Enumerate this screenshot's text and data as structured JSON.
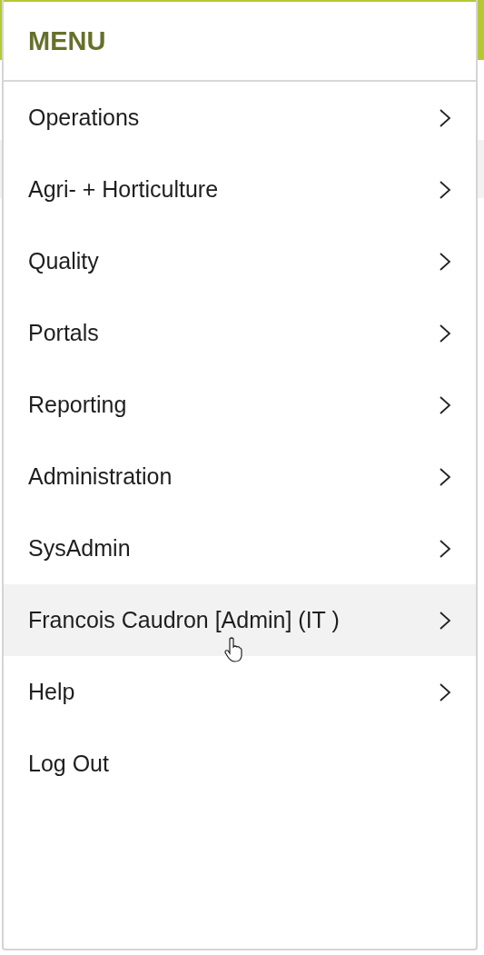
{
  "menu": {
    "title": "MENU",
    "items": [
      {
        "label": "Operations",
        "has_submenu": true,
        "highlighted": false
      },
      {
        "label": "Agri- + Horticulture",
        "has_submenu": true,
        "highlighted": false
      },
      {
        "label": "Quality",
        "has_submenu": true,
        "highlighted": false
      },
      {
        "label": "Portals",
        "has_submenu": true,
        "highlighted": false
      },
      {
        "label": "Reporting",
        "has_submenu": true,
        "highlighted": false
      },
      {
        "label": "Administration",
        "has_submenu": true,
        "highlighted": false
      },
      {
        "label": "SysAdmin",
        "has_submenu": true,
        "highlighted": false
      },
      {
        "label": "Francois Caudron [Admin] (IT )",
        "has_submenu": true,
        "highlighted": true
      },
      {
        "label": "Help",
        "has_submenu": true,
        "highlighted": false
      },
      {
        "label": "Log Out",
        "has_submenu": false,
        "highlighted": false
      }
    ]
  }
}
